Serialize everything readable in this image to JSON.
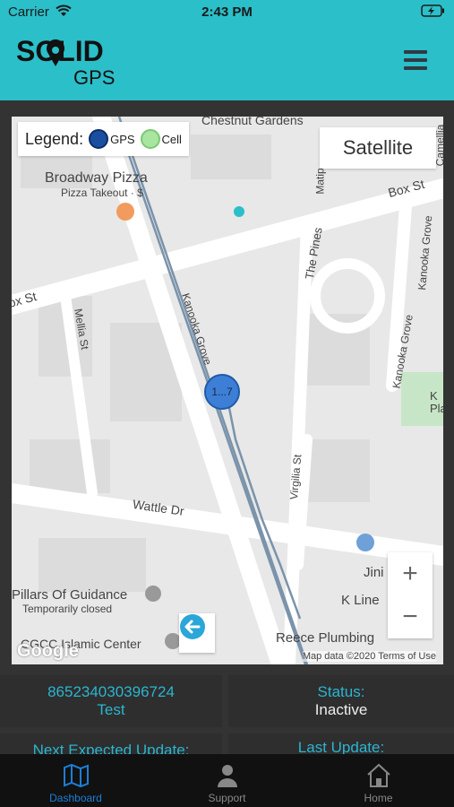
{
  "status_bar": {
    "carrier": "Carrier",
    "time": "2:43 PM"
  },
  "header": {
    "logo_top": "SOLID",
    "logo_bottom": "GPS"
  },
  "legend": {
    "title": "Legend:",
    "gps_label": "GPS",
    "cell_label": "Cell",
    "gps_color": "#1a4fa0",
    "cell_color": "#a8e6a0"
  },
  "map": {
    "satellite_label": "Satellite",
    "zoom_in": "+",
    "zoom_out": "−",
    "cluster_label": "1...7",
    "google_label": "Google",
    "attribution": "Map data ©2020   Terms of Use",
    "labels": {
      "chestnut": "Chestnut Gardens",
      "broadway": "Broadway Pizza",
      "pizza": "Pizza Takeout · $",
      "box_st_right": "Box St",
      "box_st_left": "ox St",
      "matip": "Matip",
      "camellia": "Camellia",
      "pines": "The Pines",
      "kanooka_r": "Kanooka Grove",
      "kanooka_r2": "Kanooka Grove",
      "kanooka_c": "Kanooka Grove",
      "mellia": "Mellia St",
      "virgilia": "Virgilia St",
      "wattle": "Wattle Dr",
      "jini": "Jini",
      "kline": "K Line",
      "pillars": "Pillars Of Guidance",
      "temp_closed": "Temporarily closed",
      "islamic": "CGCC Islamic Center",
      "reece": "Reece Plumbing",
      "kpla": "K\nPla"
    }
  },
  "device": {
    "id": "865234030396724",
    "name": "Test",
    "status_label": "Status:",
    "status_value": "Inactive",
    "next_update_label": "Next Expected Update:",
    "last_update_label": "Last Update:"
  },
  "tabs": [
    {
      "label": "Dashboard",
      "icon": "map-icon"
    },
    {
      "label": "Support",
      "icon": "person-icon"
    },
    {
      "label": "Home",
      "icon": "home-icon"
    }
  ]
}
